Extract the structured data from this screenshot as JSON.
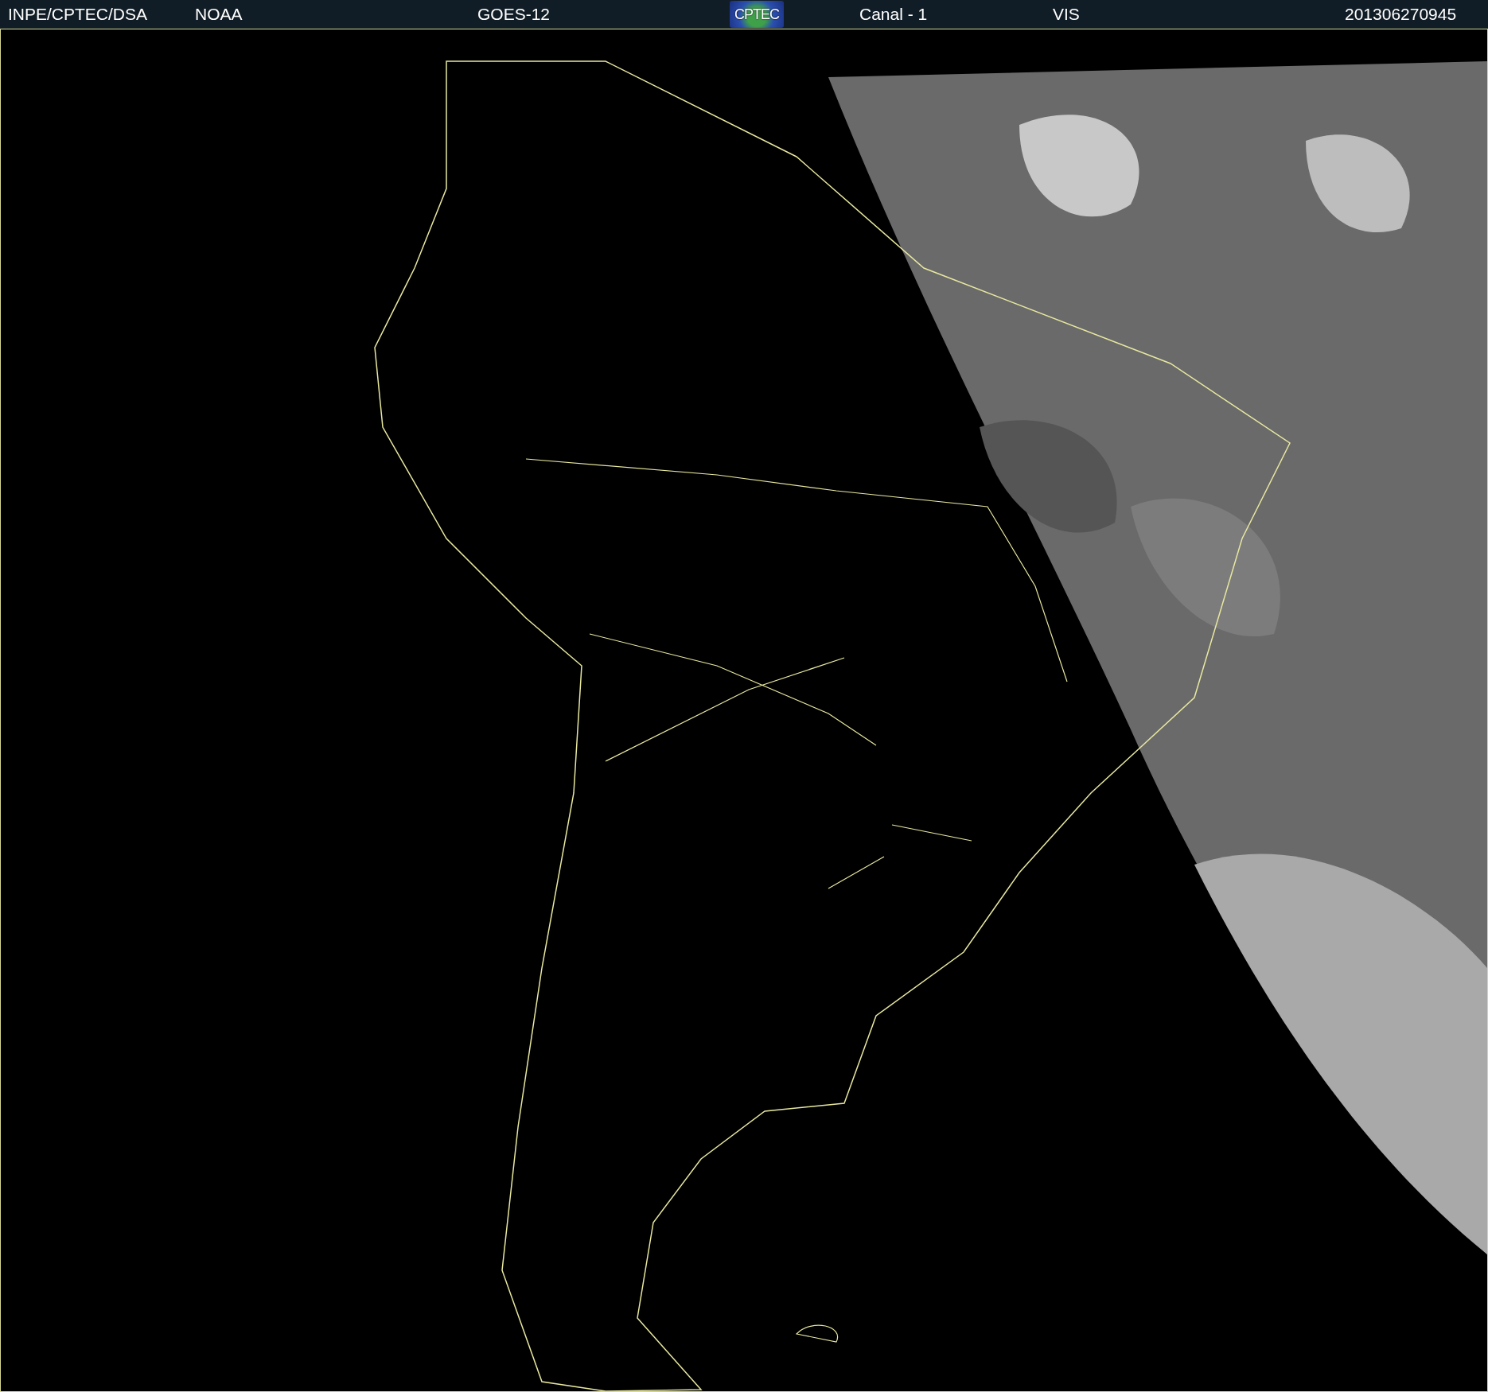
{
  "header": {
    "items": [
      {
        "kind": "text",
        "text": "INPE/CPTEC/DSA"
      },
      {
        "kind": "text",
        "text": "NOAA"
      },
      {
        "kind": "text",
        "text": "GOES-12"
      },
      {
        "kind": "logo",
        "text": "CPTEC"
      },
      {
        "kind": "text",
        "text": "Canal - 1"
      },
      {
        "kind": "text",
        "text": "VIS"
      },
      {
        "kind": "text",
        "text": "201306270945"
      }
    ]
  }
}
